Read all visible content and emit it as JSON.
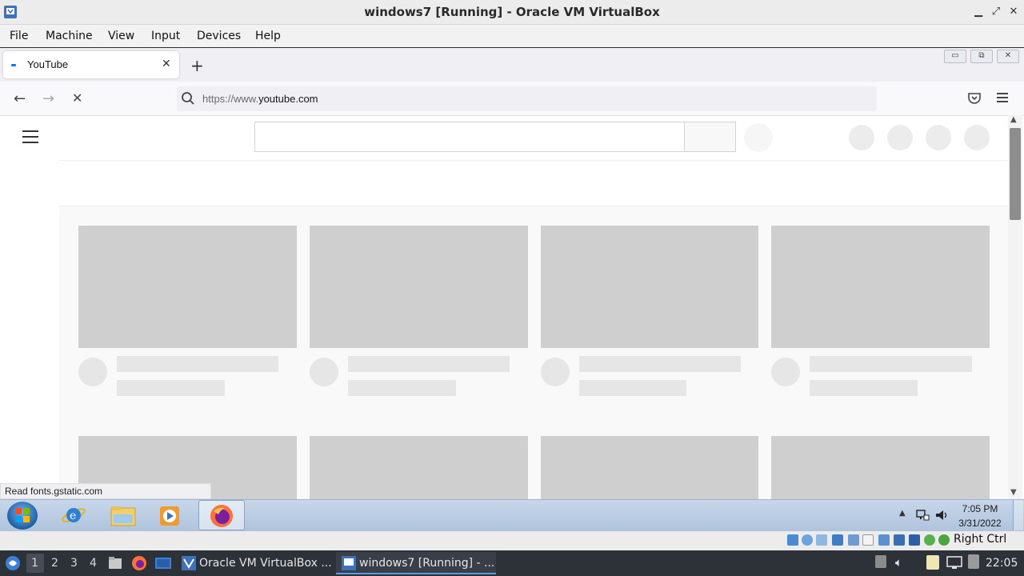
{
  "vbox": {
    "title": "windows7 [Running] - Oracle VM VirtualBox",
    "menu": [
      "File",
      "Machine",
      "View",
      "Input",
      "Devices",
      "Help"
    ],
    "host_key": "Right Ctrl"
  },
  "firefox": {
    "tab_title": "YouTube",
    "url_scheme": "https://www.",
    "url_host": "youtube.com",
    "status_text": "Read fonts.gstatic.com"
  },
  "windows_taskbar": {
    "time": "7:05 PM",
    "date": "3/31/2022"
  },
  "host_panel": {
    "workspaces": [
      "1",
      "2",
      "3",
      "4"
    ],
    "tasks": [
      "Oracle VM VirtualBox ...",
      "windows7 [Running] - ..."
    ],
    "clock": "22:05"
  },
  "colors": {
    "accent_blue": "#5e9be6",
    "youtube_skeleton": "#cfcfcf"
  }
}
